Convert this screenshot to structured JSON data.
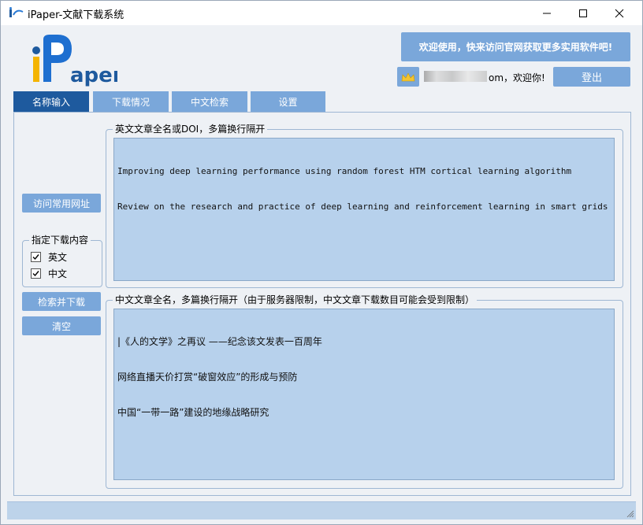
{
  "window": {
    "title": "iPaper-文献下载系统"
  },
  "logo": {
    "alt": "iPaper"
  },
  "header": {
    "welcome": "欢迎使用，快来访问官网获取更多实用软件吧!",
    "user_suffix": "om，欢迎你!",
    "logout": "登出"
  },
  "tabs": [
    {
      "label": "名称输入"
    },
    {
      "label": "下载情况"
    },
    {
      "label": "中文检索"
    },
    {
      "label": "设置"
    }
  ],
  "sidebar": {
    "visit_sites": "访问常用网址",
    "download_content_legend": "指定下载内容",
    "options": [
      {
        "label": "英文",
        "checked": true
      },
      {
        "label": "中文",
        "checked": true
      }
    ],
    "search_download": "检索并下载",
    "clear": "清空"
  },
  "english_box": {
    "legend": "英文文章全名或DOI，多篇换行隔开",
    "lines": [
      "Improving deep learning performance using random forest HTM cortical learning algorithm",
      "Review on the research and practice of deep learning and reinforcement learning in smart grids"
    ]
  },
  "chinese_box": {
    "legend": "中文文章全名，多篇换行隔开（由于服务器限制，中文文章下载数目可能会受到限制）",
    "lines": [
      "|《人的文学》之再议 ——纪念该文发表一百周年",
      "网络直播天价打赏“破窗效应”的形成与预防",
      "中国“一带一路”建设的地缘战略研究"
    ]
  },
  "colors": {
    "accent": "#7aa7da",
    "tab_active": "#1e5a9e",
    "textarea_bg": "#b7d1ec",
    "panel_bg": "#eef1f5"
  }
}
